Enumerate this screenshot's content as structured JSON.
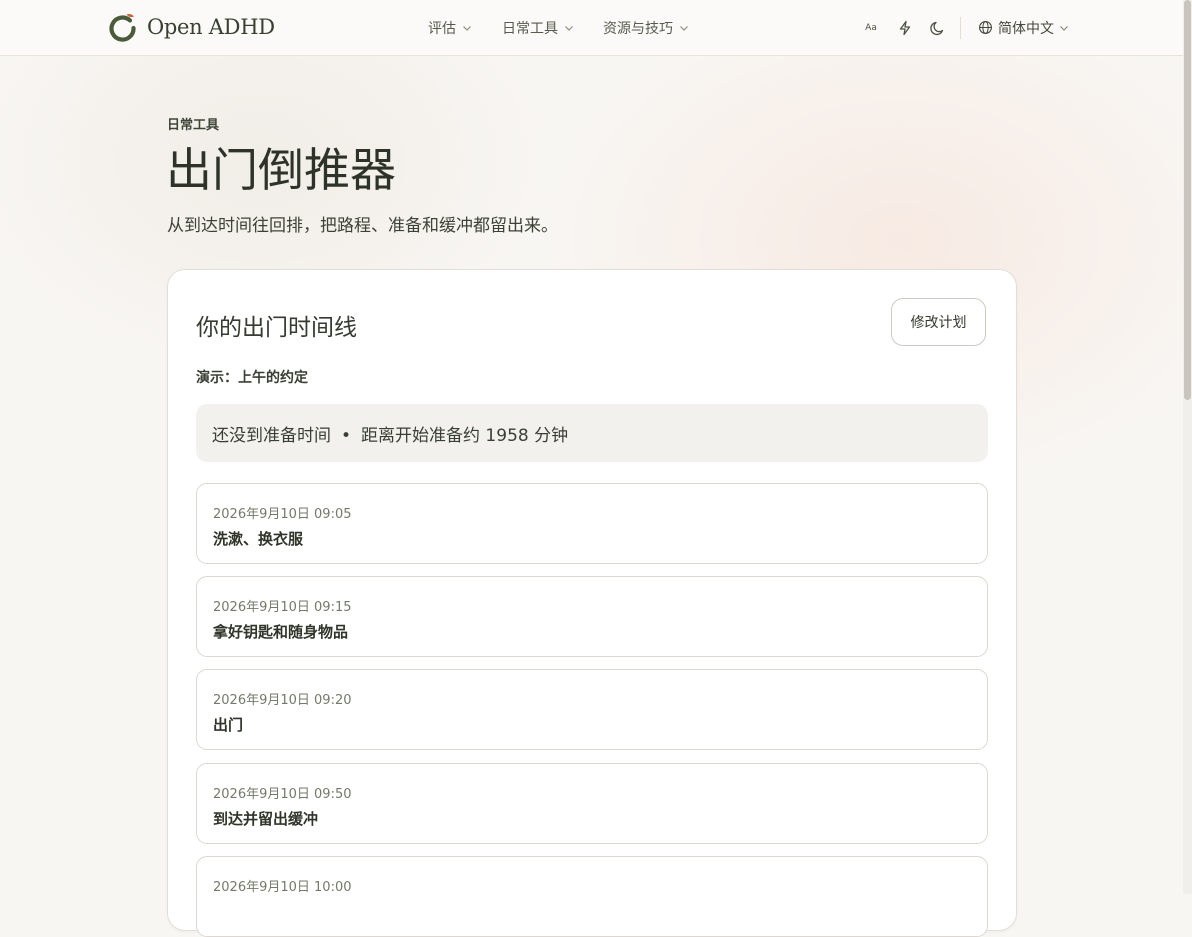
{
  "header": {
    "brand": "Open ADHD",
    "nav": [
      {
        "label": "评估"
      },
      {
        "label": "日常工具"
      },
      {
        "label": "资源与技巧"
      }
    ],
    "font_size_icon_text": "Aa",
    "language": "简体中文"
  },
  "page": {
    "eyebrow": "日常工具",
    "title": "出门倒推器",
    "subtitle": "从到达时间往回排，把路程、准备和缓冲都留出来。"
  },
  "card": {
    "title": "你的出门时间线",
    "edit_label": "修改计划",
    "demo_label": "演示：上午的约定",
    "status_main": "还没到准备时间",
    "status_separator": "•",
    "status_detail": "距离开始准备约 1958 分钟",
    "steps": [
      {
        "time": "2026年9月10日 09:05",
        "label": "洗漱、换衣服"
      },
      {
        "time": "2026年9月10日 09:15",
        "label": "拿好钥匙和随身物品"
      },
      {
        "time": "2026年9月10日 09:20",
        "label": "出门"
      },
      {
        "time": "2026年9月10日 09:50",
        "label": "到达并留出缓冲"
      },
      {
        "time": "2026年9月10日 10:00",
        "label": ""
      }
    ]
  },
  "colors": {
    "brand_green": "#4a5a3a",
    "brand_accent": "#c4683c",
    "background": "#f8f6f3",
    "card_border": "#e3dfd8"
  }
}
